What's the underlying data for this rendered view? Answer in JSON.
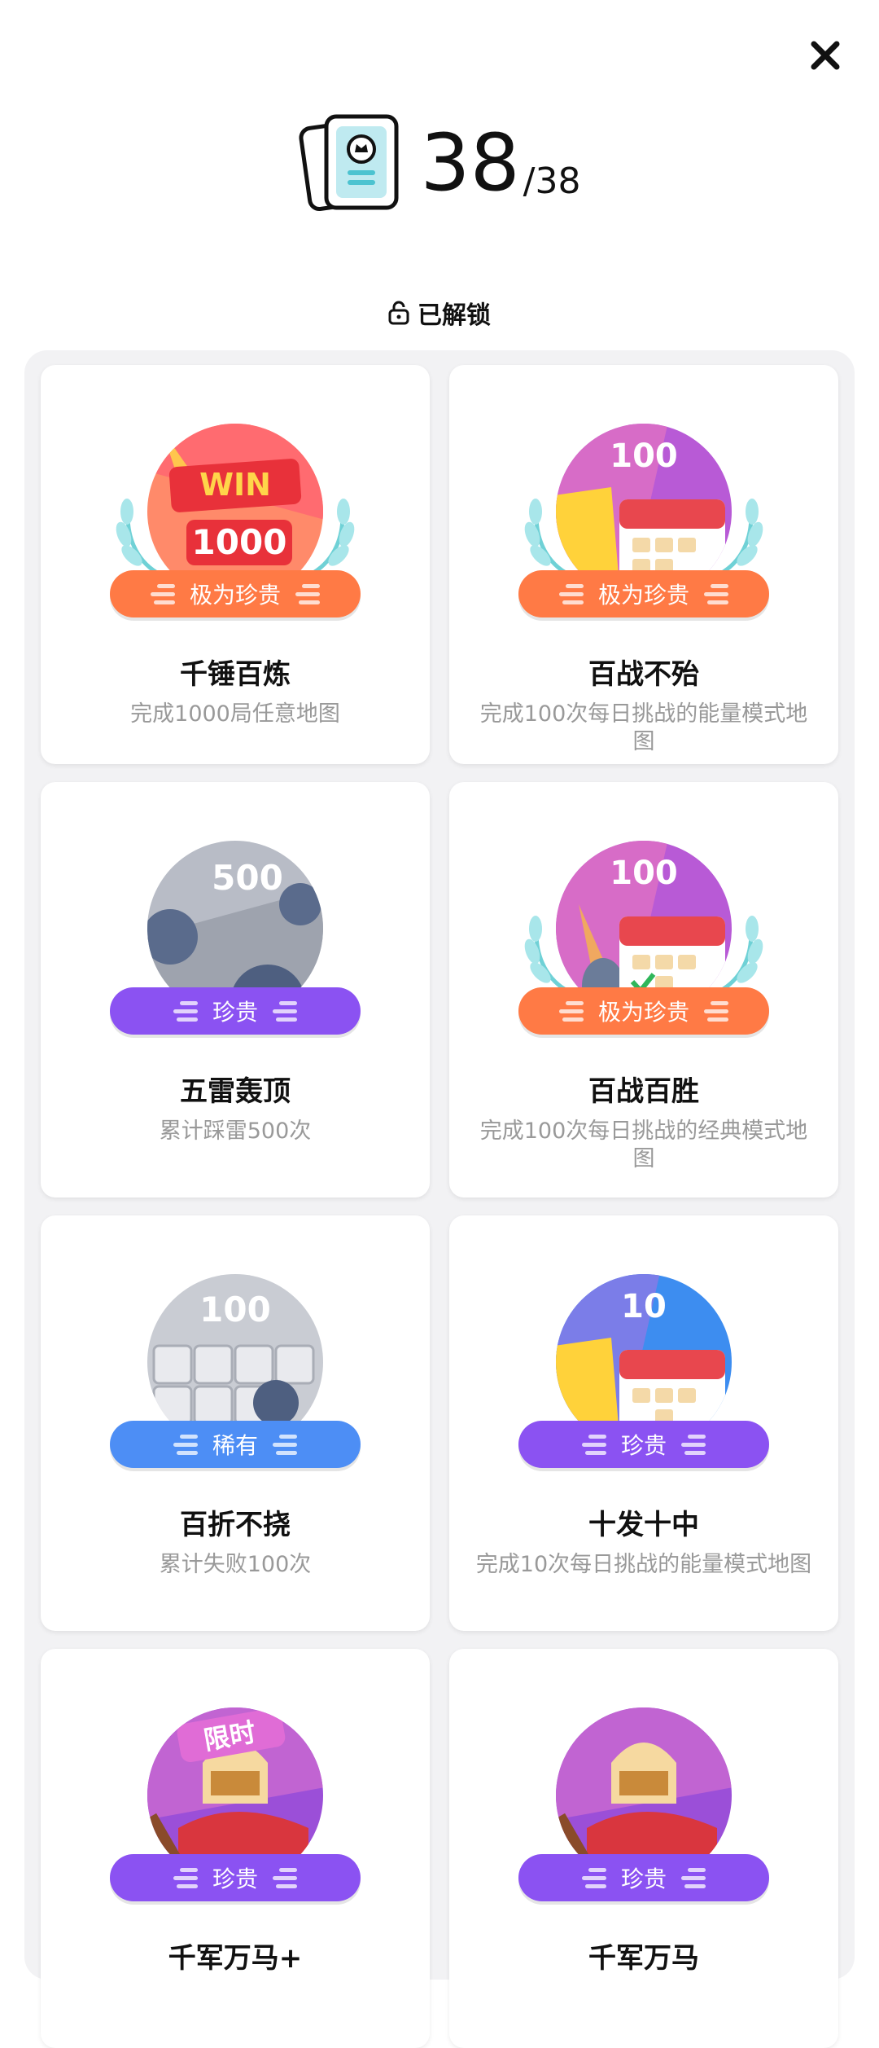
{
  "header": {
    "count": "38",
    "total": "/38",
    "unlocked_label": "已解锁"
  },
  "achievements": [
    {
      "title": "千锤百炼",
      "desc": "完成1000局任意地图",
      "rarity": "极为珍贵",
      "badge_text": "1000",
      "badge_top": "WIN"
    },
    {
      "title": "百战不殆",
      "desc": "完成100次每日挑战的能量模式地图",
      "rarity": "极为珍贵",
      "badge_text": "100"
    },
    {
      "title": "五雷轰顶",
      "desc": "累计踩雷500次",
      "rarity": "珍贵",
      "badge_text": "500"
    },
    {
      "title": "百战百胜",
      "desc": "完成100次每日挑战的经典模式地图",
      "rarity": "极为珍贵",
      "badge_text": "100"
    },
    {
      "title": "百折不挠",
      "desc": "累计失败100次",
      "rarity": "稀有",
      "badge_text": "100"
    },
    {
      "title": "十发十中",
      "desc": "完成10次每日挑战的能量模式地图",
      "rarity": "珍贵",
      "badge_text": "10"
    },
    {
      "title": "千军万马+",
      "desc": "",
      "rarity": "珍贵",
      "badge_text": "限时"
    },
    {
      "title": "千军万马",
      "desc": "",
      "rarity": "珍贵",
      "badge_text": ""
    }
  ],
  "colors": {
    "rarity_very_precious": "#ff7a45",
    "rarity_precious": "#8b52f2",
    "rarity_rare": "#4d8ef5"
  },
  "icons": [
    "close-icon",
    "collection-cards-icon",
    "unlock-icon",
    "laurel-icon",
    "trophy-badge-icon",
    "calendar-badge-icon",
    "mine-badge-icon",
    "knight-badge-icon"
  ]
}
